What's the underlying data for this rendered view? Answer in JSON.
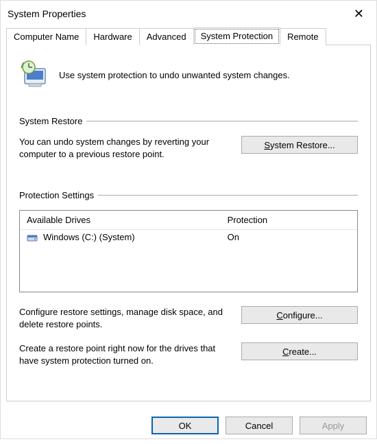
{
  "window": {
    "title": "System Properties",
    "close_glyph": "✕"
  },
  "tabs": {
    "computer_name": "Computer Name",
    "hardware": "Hardware",
    "advanced": "Advanced",
    "system_protection": "System Protection",
    "remote": "Remote"
  },
  "intro_text": "Use system protection to undo unwanted system changes.",
  "system_restore": {
    "group_label": "System Restore",
    "desc": "You can undo system changes by reverting your computer to a previous restore point.",
    "button_label_full": "System Restore...",
    "button_prefix": "S",
    "button_rest": "ystem Restore..."
  },
  "protection_settings": {
    "group_label": "Protection Settings",
    "header_drives": "Available Drives",
    "header_protection": "Protection",
    "drives": [
      {
        "name": "Windows (C:) (System)",
        "protection": "On"
      }
    ],
    "configure_desc": "Configure restore settings, manage disk space, and delete restore points.",
    "configure_label_full": "Configure...",
    "configure_prefix": "C",
    "configure_rest": "onfigure...",
    "create_desc": "Create a restore point right now for the drives that have system protection turned on.",
    "create_label_full": "Create...",
    "create_prefix": "C",
    "create_rest": "reate..."
  },
  "footer": {
    "ok": "OK",
    "cancel": "Cancel",
    "apply": "Apply"
  }
}
